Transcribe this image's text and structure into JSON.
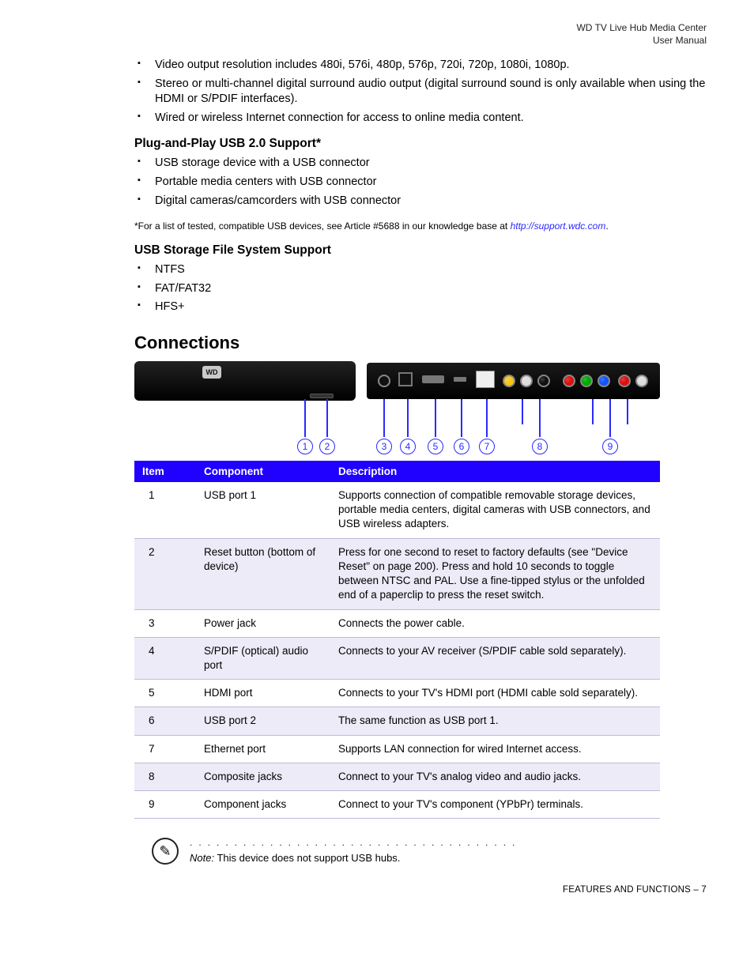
{
  "header": {
    "line1": "WD TV Live Hub Media Center",
    "line2": "User Manual"
  },
  "top_bullets": [
    "Video output resolution includes 480i, 576i, 480p, 576p, 720i, 720p, 1080i, 1080p.",
    "Stereo or multi-channel digital surround audio output (digital surround sound is only available when using the HDMI or S/PDIF interfaces).",
    "Wired or wireless Internet connection for access to online media content."
  ],
  "usb_support": {
    "heading": "Plug-and-Play USB 2.0 Support*",
    "items": [
      "USB storage device with a USB connector",
      "Portable media centers with USB connector",
      "Digital cameras/camcorders with USB connector"
    ],
    "footnote_prefix": "*For a list of tested, compatible USB devices, see Article #5688 in our knowledge base at ",
    "footnote_link": "http://support.wdc.com",
    "footnote_suffix": "."
  },
  "fs_support": {
    "heading": "USB Storage File System Support",
    "items": [
      "NTFS",
      "FAT/FAT32",
      "HFS+"
    ]
  },
  "connections": {
    "heading": "Connections",
    "table_headers": {
      "item": "Item",
      "component": "Component",
      "description": "Description"
    },
    "rows": [
      {
        "item": "1",
        "component": "USB port 1",
        "description": "Supports connection of compatible removable storage devices, portable media centers, digital cameras with USB connectors, and USB wireless adapters."
      },
      {
        "item": "2",
        "component": "Reset button (bottom of device)",
        "description": "Press for one second to reset to factory defaults (see \"Device Reset\" on page 200). Press and hold 10 seconds to toggle between NTSC and PAL. Use a fine-tipped stylus or the unfolded end of a paperclip to press the reset switch."
      },
      {
        "item": "3",
        "component": "Power jack",
        "description": "Connects the power cable."
      },
      {
        "item": "4",
        "component": "S/PDIF (optical) audio port",
        "description": "Connects to your AV receiver (S/PDIF cable sold separately)."
      },
      {
        "item": "5",
        "component": "HDMI port",
        "description": "Connects to your TV's HDMI port (HDMI cable sold separately)."
      },
      {
        "item": "6",
        "component": "USB port 2",
        "description": "The same function as USB port 1."
      },
      {
        "item": "7",
        "component": "Ethernet port",
        "description": "Supports LAN connection for wired Internet access."
      },
      {
        "item": "8",
        "component": "Composite jacks",
        "description": "Connect to your TV's analog video and audio jacks."
      },
      {
        "item": "9",
        "component": "Component jacks",
        "description": "Connect to your TV's component (YPbPr) terminals."
      }
    ],
    "callouts": [
      "1",
      "2",
      "3",
      "4",
      "5",
      "6",
      "7",
      "8",
      "9"
    ]
  },
  "note": {
    "label": "Note:",
    "text": " This device does not support USB hubs."
  },
  "footer": {
    "section": "FEATURES AND FUNCTIONS",
    "sep": " – ",
    "page": "7"
  }
}
